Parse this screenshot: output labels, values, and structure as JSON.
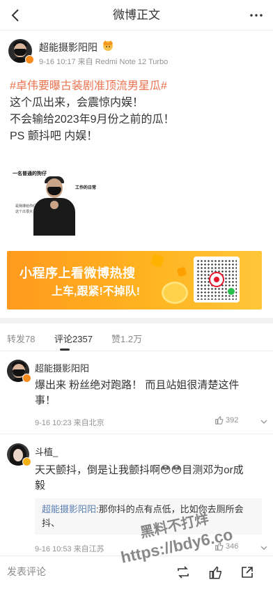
{
  "nav": {
    "title": "微博正文"
  },
  "post": {
    "author": "超能摄影阳阳",
    "meta": "9-16 10:17 来自 Redmi Note 12 Turbo",
    "topic": "#卓伟要曝古装剧准顶流男星瓜#",
    "lines": [
      "这个瓜出来，会震惊内娱！",
      "不会输给2023年9月份之前的瓜！",
      "PS 颤抖吧 内娱！"
    ],
    "meme": {
      "caption_left": "一名普通的狗仔",
      "caption_right": "工作的日常",
      "small1": "是我爆给你们的",
      "small2": "这个瓜很大"
    }
  },
  "banner": {
    "line1": "小程序上看微博热搜",
    "line2": "上车,跟紧!不掉队!"
  },
  "tabs": {
    "repost": "转发78",
    "comments": "评论2357",
    "likes": "赞1.2万"
  },
  "comments": [
    {
      "name": "超能摄影阳阳",
      "text_lines": [
        "爆出来 粉丝绝对跑路！ 而且站姐很清楚这件",
        "事！"
      ],
      "meta": "9-16 10:23 来自北京",
      "likes": "392"
    },
    {
      "name": "斗植_",
      "text_lines": [
        "天天颤抖，倒是让我颤抖啊😳😳目测邓为or成",
        "毅"
      ],
      "reply_name": "超能摄影阳阳",
      "reply_text": ":那你抖的点有点低，比如你去厕所会抖、",
      "meta": "9-16 10:53 来自江苏",
      "likes": "346"
    }
  ],
  "bottom": {
    "input_placeholder": "发表评论"
  },
  "watermark": {
    "line1": "黑料不打烊",
    "line2": "https://bdy6.co"
  },
  "colors": {
    "topic": "#eb7350",
    "link_name": "#5b7fb1",
    "banner": "#ffb31f"
  }
}
